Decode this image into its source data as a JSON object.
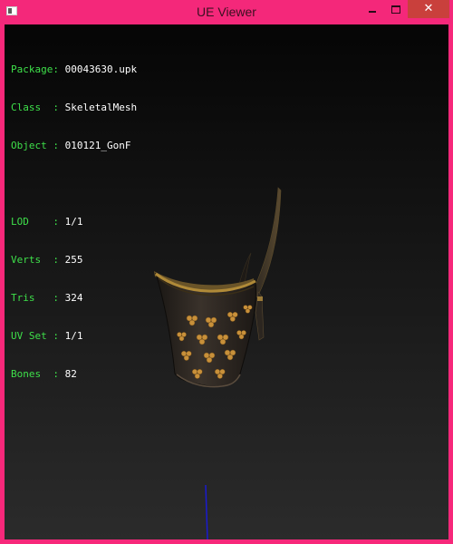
{
  "window": {
    "title": "UE Viewer",
    "minimize_symbol": "–",
    "maximize_symbol": "□",
    "close_symbol": "✕"
  },
  "info": {
    "package": {
      "label": "Package:",
      "value": "00043630.upk"
    },
    "class": {
      "label": "Class  :",
      "value": "SkeletalMesh"
    },
    "object": {
      "label": "Object :",
      "value": "010121_GonF"
    },
    "lod": {
      "label": "LOD    :",
      "value": "1/1"
    },
    "verts": {
      "label": "Verts  :",
      "value": "255"
    },
    "tris": {
      "label": "Tris   :",
      "value": "324"
    },
    "uvset": {
      "label": "UV Set :",
      "value": "1/1"
    },
    "bones": {
      "label": "Bones  :",
      "value": "82"
    }
  },
  "colors": {
    "window_frame": "#f7287a",
    "label_text": "#3ee04a",
    "value_text": "#ffffff",
    "axis_line": "#1010c0",
    "mesh_body": "#2a2420",
    "mesh_trim": "#a88530",
    "mesh_studs": "#c08a35"
  }
}
